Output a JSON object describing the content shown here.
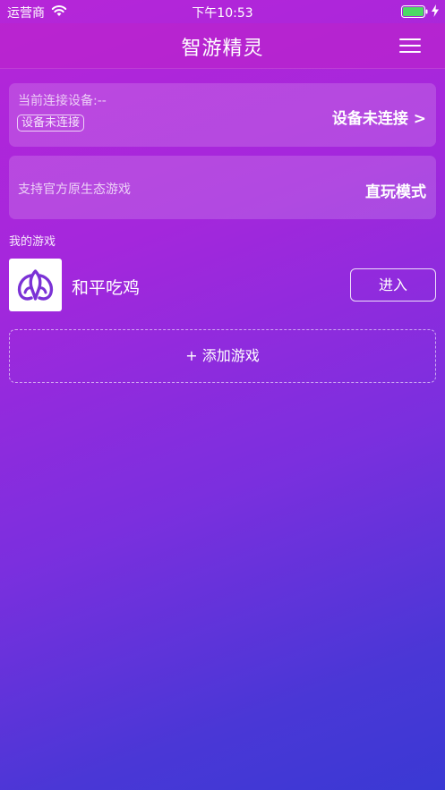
{
  "status_bar": {
    "carrier": "运营商",
    "time": "下午10:53",
    "icons": [
      "wifi-icon",
      "battery-icon",
      "charging-bolt-icon"
    ],
    "battery_level": 1.0
  },
  "nav": {
    "title": "智游精灵",
    "menu_icon": "hamburger-menu-icon"
  },
  "device_card": {
    "label": "当前连接设备:--",
    "badge": "设备未连接",
    "action": "设备未连接 >"
  },
  "mode_card": {
    "label": "支持官方原生态游戏",
    "action": "直玩模式"
  },
  "my_games": {
    "title": "我的游戏",
    "items": [
      {
        "name": "和平吃鸡",
        "icon": "game-logo-icon",
        "enter_label": "进入"
      }
    ],
    "add_label": "+ 添加游戏"
  },
  "colors": {
    "gradient_top": "#b626d8",
    "gradient_bottom": "#3a39d4",
    "battery_green": "#4cd964",
    "logo_purple": "#7b32d6"
  }
}
